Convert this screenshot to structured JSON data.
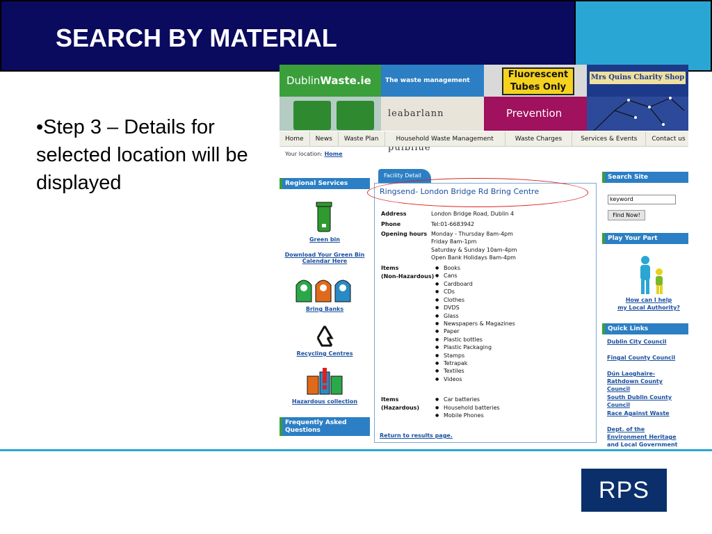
{
  "slide": {
    "title": "SEARCH BY MATERIAL",
    "bullet": "•Step 3 – Details for selected location will be displayed",
    "logo": "RPS"
  },
  "banner": {
    "brand_prefix": "Dublin",
    "brand_bold": "Waste.ie",
    "tagline": "The waste management website",
    "sign_text": "Fluorescent Tubes Only",
    "shop_text": "Mrs Quins Charity Shop",
    "library_text": "leabarlann puibliúe",
    "prevention": "Prevention"
  },
  "nav": [
    "Home",
    "News",
    "Waste Plan",
    "Household Waste Management",
    "Waste Charges",
    "Services & Events",
    "Contact us"
  ],
  "location": {
    "label": "Your location:",
    "link": "Home"
  },
  "left_sidebar": {
    "header": "Regional Services",
    "green_bin": "Green bin",
    "download": "Download Your Green Bin Calendar Here",
    "bring_banks": "Bring Banks",
    "recycling": "Recycling Centres",
    "hazardous": "Hazardous collection",
    "faq": "Frequently Asked Questions"
  },
  "facility": {
    "tab": "Facility Detail",
    "name": "Ringsend- London Bridge Rd Bring Centre",
    "address_label": "Address",
    "address": "London Bridge Road, Dublin 4",
    "phone_label": "Phone",
    "phone": "Tel:01-6683942",
    "hours_label": "Opening hours",
    "hours": [
      "Monday - Thursday 8am-4pm",
      "Friday 8am-1pm",
      "Saturday & Sunday 10am-4pm",
      "Open Bank Holidays 8am-4pm"
    ],
    "items_nh_label1": "Items",
    "items_nh_label2": "(Non-Hazardous)",
    "items_nh": [
      "Books",
      "Cans",
      "Cardboard",
      "CDs",
      "Clothes",
      "DVDS",
      "Glass",
      "Newspapers & Magazines",
      "Paper",
      "Plastic bottles",
      "Plastic Packaging",
      "Stamps",
      "Tetrapak",
      "Textiles",
      "Videos"
    ],
    "items_h_label1": "Items",
    "items_h_label2": "(Hazardous)",
    "items_h": [
      "Car batteries",
      "Household batteries",
      "Mobile Phones"
    ],
    "return": "Return to results page."
  },
  "right_sidebar": {
    "search_header": "Search Site",
    "search_value": "keyword",
    "find_button": "Find Now!",
    "play_header": "Play Your Part",
    "help1": "How can I help",
    "help2": "my Local Authority?",
    "quick_header": "Quick Links",
    "links": [
      "Dublin City Council",
      "Fingal County Council",
      "Dún Laoghaire-Rathdown County Council",
      "South Dublin County Council",
      "Race Against Waste",
      "Dept. of the Environment Heritage and Local Government"
    ]
  },
  "colors": {
    "navy": "#0a0a5e",
    "cyan": "#2aa6d4",
    "site_blue": "#2c7fc4",
    "site_green": "#3a9f3a",
    "highlight": "#e02020"
  }
}
